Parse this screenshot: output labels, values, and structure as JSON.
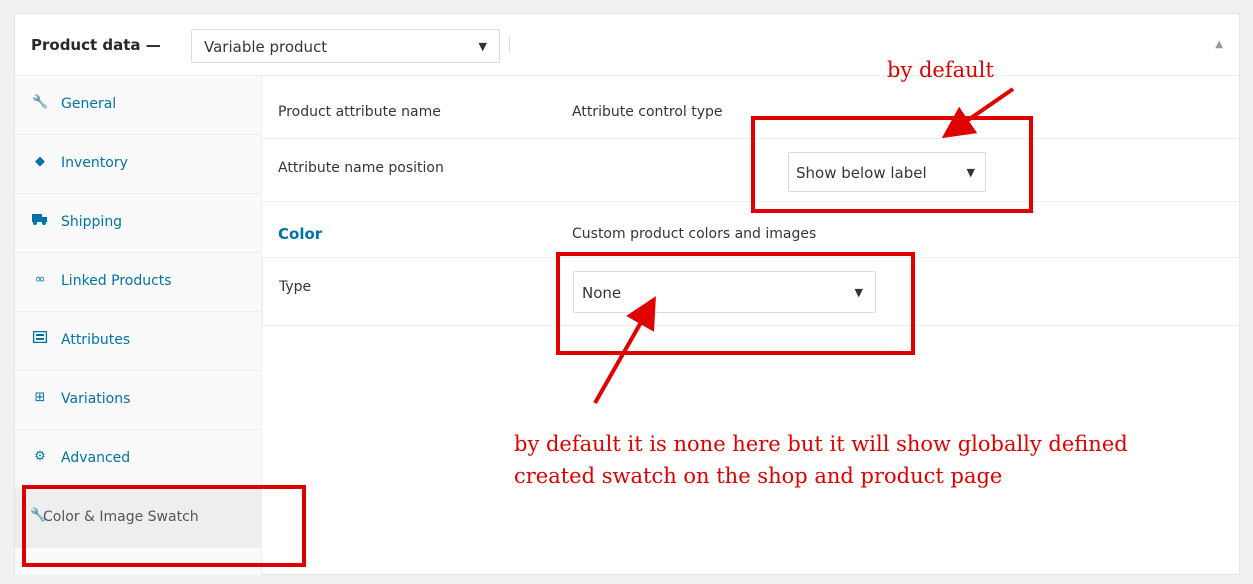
{
  "header": {
    "title": "Product data —",
    "product_type": "Variable product"
  },
  "tabs": [
    {
      "label": "General",
      "icon": "wrench-icon"
    },
    {
      "label": "Inventory",
      "icon": "tag-icon"
    },
    {
      "label": "Shipping",
      "icon": "truck-icon"
    },
    {
      "label": "Linked Products",
      "icon": "link-icon"
    },
    {
      "label": "Attributes",
      "icon": "list-icon"
    },
    {
      "label": "Variations",
      "icon": "grid-icon"
    },
    {
      "label": "Advanced",
      "icon": "gear-icon"
    },
    {
      "label": "Color & Image Swatch",
      "icon": "wrench-icon",
      "active": true
    }
  ],
  "settings": {
    "col1_header": "Product attribute name",
    "col2_header": "Attribute control type",
    "position_label": "Attribute name position",
    "position_value": "Show below label",
    "attribute_name": "Color",
    "attribute_desc": "Custom product colors and images",
    "type_label": "Type",
    "type_value": "None"
  },
  "annotations": {
    "top": "by default",
    "bottom": "by default it is none here but it will show globally defined created swatch on the shop and product page",
    "color": "#e00000"
  }
}
